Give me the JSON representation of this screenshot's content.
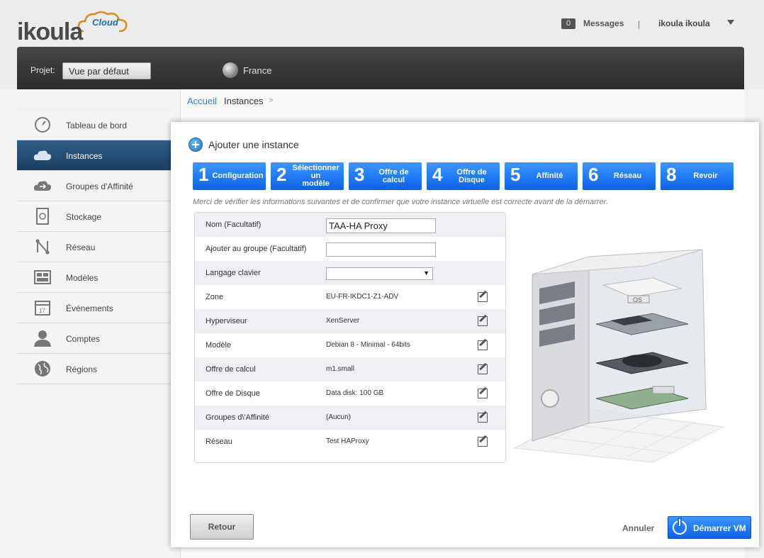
{
  "header": {
    "logo_text": "ikoula",
    "logo_badge": "Cloud",
    "messages_count": "0",
    "messages_label": "Messages",
    "separator": "|",
    "user_name": "ikoula ikoula"
  },
  "project_bar": {
    "project_label": "Projet:",
    "project_value": "Vue par défaut",
    "region": "France"
  },
  "sidebar": {
    "items": [
      {
        "label": "Tableau de bord",
        "icon": "dashboard-icon"
      },
      {
        "label": "Instances",
        "icon": "cloud-icon",
        "active": true
      },
      {
        "label": "Groupes d'Affinité",
        "icon": "affinity-icon"
      },
      {
        "label": "Stockage",
        "icon": "storage-icon"
      },
      {
        "label": "Réseau",
        "icon": "network-icon"
      },
      {
        "label": "Modèles",
        "icon": "templates-icon"
      },
      {
        "label": "Événements",
        "icon": "calendar-icon"
      },
      {
        "label": "Comptes",
        "icon": "user-icon"
      },
      {
        "label": "Régions",
        "icon": "globe-icon"
      }
    ]
  },
  "breadcrumb": {
    "home": "Accueil",
    "current": "Instances",
    "arrow": ">"
  },
  "modal": {
    "title": "Ajouter une instance",
    "steps": [
      {
        "num": "1",
        "label": "Configuration"
      },
      {
        "num": "2",
        "label": "Sélectionner un\nmodèle"
      },
      {
        "num": "3",
        "label": "Offre de calcul"
      },
      {
        "num": "4",
        "label": "Offre de Disque"
      },
      {
        "num": "5",
        "label": "Affinité"
      },
      {
        "num": "6",
        "label": "Réseau"
      },
      {
        "num": "8",
        "label": "Revoir"
      }
    ],
    "note": "Merci de vérifier les informations suivantes et de confirmer que votre instance virtuelle est correcte avant de la démarrer.",
    "review": {
      "name_label": "Nom (Facultatif)",
      "name_value": "TAA-HA Proxy",
      "group_label": "Ajouter au groupe (Facultatif)",
      "group_value": "",
      "keyboard_label": "Langage clavier",
      "rows": [
        {
          "label": "Zone",
          "value": "EU-FR-IKDC1-Z1-ADV"
        },
        {
          "label": "Hyperviseur",
          "value": "XenServer"
        },
        {
          "label": "Modèle",
          "value": "Debian 8 - Minimal - 64bits"
        },
        {
          "label": "Offre de calcul",
          "value": "m1.small"
        },
        {
          "label": "Offre de Disque",
          "value": "Data disk: 100 GB"
        },
        {
          "label": "Groupes d\\'Affinité",
          "value": "(Aucun)"
        },
        {
          "label": "Réseau",
          "value": "Test HAProxy"
        }
      ]
    },
    "illustration_label": "OS",
    "buttons": {
      "back": "Retour",
      "cancel": "Annuler",
      "start": "Démarrer VM"
    }
  },
  "colors": {
    "step_blue": "#1772ef",
    "active_nav": "#24496e",
    "header_dark": "#383838"
  }
}
